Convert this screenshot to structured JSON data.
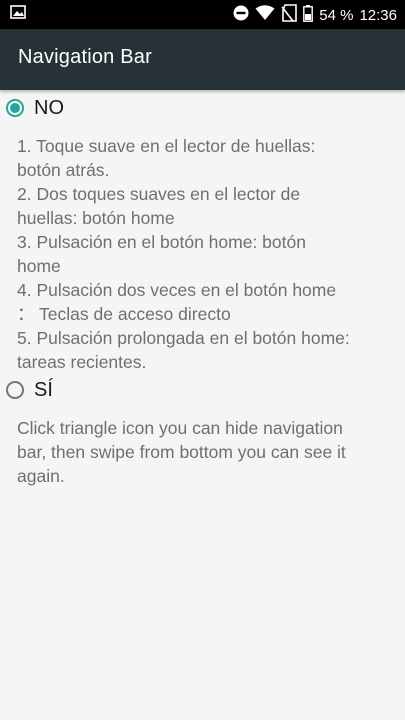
{
  "status_bar": {
    "battery_percent": "54 %",
    "time": "12:36",
    "icons": [
      "image-notification-icon",
      "do-not-disturb-icon",
      "wifi-icon",
      "no-sim-icon",
      "battery-icon"
    ]
  },
  "app_bar": {
    "title": "Navigation Bar",
    "background": "#263238"
  },
  "options": [
    {
      "label": "NO",
      "checked": true,
      "description_lines": [
        "1. Toque suave en el lector de huellas:",
        "botón atrás.",
        "2. Dos toques suaves en el lector de",
        "huellas: botón home",
        "3. Pulsación en el botón home: botón",
        "home",
        "4. Pulsación dos veces en el botón home",
        "： Teclas de acceso directo",
        "5. Pulsación prolongada en el botón home:",
        "tareas recientes."
      ]
    },
    {
      "label": "SÍ",
      "checked": false,
      "description_lines": [
        "Click triangle icon you can hide navigation",
        "bar, then swipe from bottom you can see it",
        "again."
      ]
    }
  ],
  "colors": {
    "accent": "#26a69a",
    "text_secondary": "#6f6f6f",
    "page_background": "#f5f5f5"
  }
}
